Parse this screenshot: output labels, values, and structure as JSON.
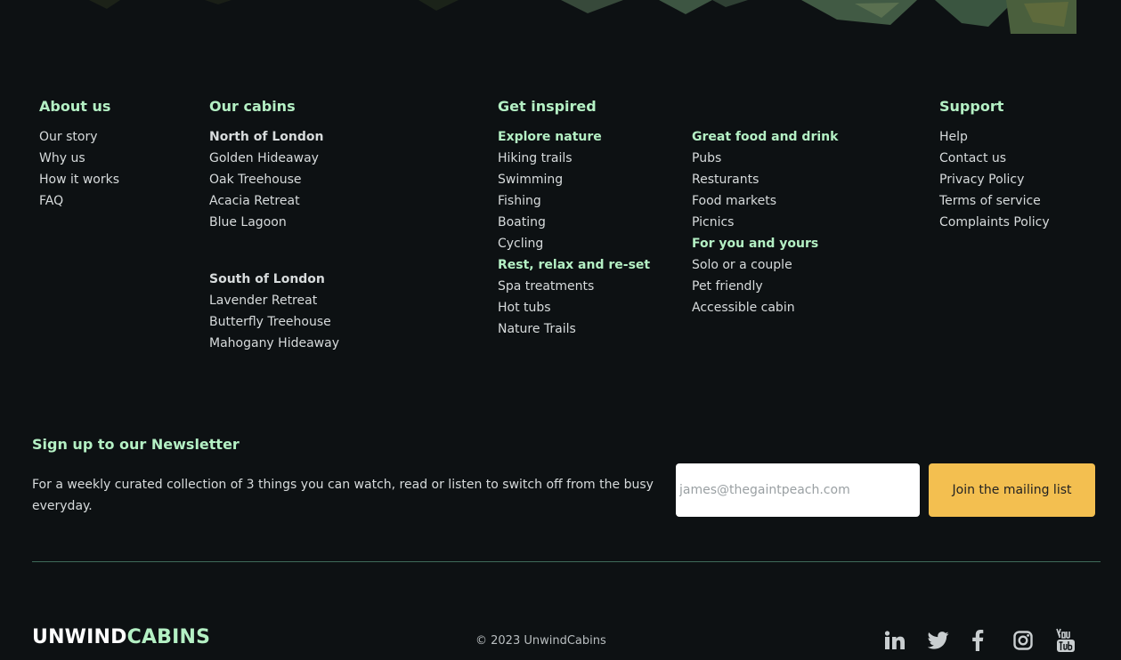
{
  "footer": {
    "columns": [
      {
        "title": "About us",
        "items": [
          {
            "label": "Our story"
          },
          {
            "label": "Why us"
          },
          {
            "label": "How it works"
          },
          {
            "label": "FAQ"
          }
        ]
      },
      {
        "title": "Our cabins",
        "groups": [
          {
            "heading": "North of London",
            "items": [
              {
                "label": "Golden Hideaway"
              },
              {
                "label": "Oak Treehouse"
              },
              {
                "label": "Acacia Retreat"
              },
              {
                "label": "Blue Lagoon"
              }
            ]
          },
          {
            "heading": "South of London",
            "items": [
              {
                "label": "Lavender Retreat"
              },
              {
                "label": "Butterfly Treehouse"
              },
              {
                "label": "Mahogany Hideaway"
              }
            ]
          }
        ]
      },
      {
        "title": "Get inspired",
        "groups": [
          {
            "heading": "Explore nature",
            "items": [
              {
                "label": "Hiking trails"
              },
              {
                "label": "Swimming"
              },
              {
                "label": "Fishing"
              },
              {
                "label": "Boating"
              },
              {
                "label": "Cycling"
              }
            ]
          },
          {
            "heading": "Rest, relax and re-set",
            "items": [
              {
                "label": "Spa treatments"
              },
              {
                "label": "Hot tubs"
              },
              {
                "label": "Nature Trails"
              }
            ]
          },
          {
            "heading": "Great food and drink",
            "items": [
              {
                "label": "Pubs"
              },
              {
                "label": "Resturants"
              },
              {
                "label": "Food markets"
              },
              {
                "label": "Picnics"
              }
            ]
          },
          {
            "heading": "For you and yours",
            "items": [
              {
                "label": "Solo or a couple"
              },
              {
                "label": "Pet friendly"
              },
              {
                "label": "Accessible cabin"
              }
            ]
          }
        ]
      },
      {
        "title": "Support",
        "items": [
          {
            "label": "Help"
          },
          {
            "label": "Contact us"
          },
          {
            "label": "Privacy Policy"
          },
          {
            "label": "Terms of service"
          },
          {
            "label": "Complaints Policy"
          }
        ]
      }
    ],
    "newsletter": {
      "title": "Sign up to our Newsletter",
      "description": "For a weekly curated collection of 3 things you can watch, read or listen to switch off from the busy everyday.",
      "email_placeholder": "james@thegaintpeach.com",
      "button_label": "Join the mailing list"
    },
    "bottom": {
      "logo_part1": "UNWIND",
      "logo_part2": "CABINS",
      "copyright": "© 2023 UnwindCabins",
      "socials": [
        {
          "icon": "linkedin-icon"
        },
        {
          "icon": "twitter-icon"
        },
        {
          "icon": "facebook-icon"
        },
        {
          "icon": "instagram-icon"
        },
        {
          "icon": "youtube-icon"
        }
      ]
    }
  },
  "colors": {
    "background": "#0d1113",
    "accent_green": "#b4f0c4",
    "button_yellow": "#f3bf50",
    "divider": "#3f6b5a"
  }
}
